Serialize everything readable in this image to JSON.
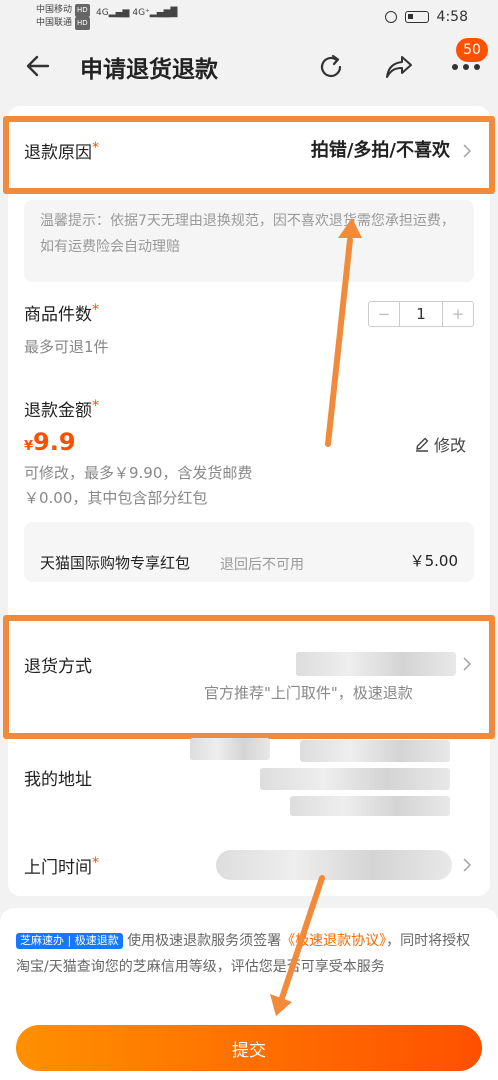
{
  "status_bar": {
    "carrier1": "中国移动",
    "carrier2": "中国联通",
    "hd": "HD",
    "net1": "4G",
    "net2": "4G⁺",
    "time": "4:58"
  },
  "nav": {
    "title": "申请退货退款",
    "badge": "50"
  },
  "refund_reason": {
    "label": "退款原因",
    "required": "*",
    "value": "拍错/多拍/不喜欢"
  },
  "tip": {
    "text": "温馨提示：依据7天无理由退换规范，因不喜欢退货需您承担运费，如有运费险会自动理赔"
  },
  "quantity": {
    "label": "商品件数",
    "required": "*",
    "sub": "最多可退1件",
    "minus": "−",
    "value": "1",
    "plus": "+"
  },
  "refund_amount": {
    "label": "退款金额",
    "required": "*",
    "currency": "¥",
    "value": "9.9",
    "edit_label": "修改",
    "note_line1": "可修改，最多￥9.90，含发货邮费",
    "note_line2": "￥0.00，其中包含部分红包"
  },
  "red_packet": {
    "title": "天猫国际购物专享红包",
    "note": "退回后不可用",
    "value": "￥5.00"
  },
  "return_method": {
    "label": "退货方式",
    "sub": "官方推荐\"上门取件\"，极速退款"
  },
  "address": {
    "label": "我的地址"
  },
  "pickup_time": {
    "label": "上门时间",
    "required": "*"
  },
  "agreement": {
    "badge": "芝麻速办 | 极速退款",
    "text1": "使用极速退款服务须签署",
    "link": "《极速退款协议》",
    "text2": "，同时将授权淘宝/天猫查询您的芝麻信用等级，评估您是否可享受本服务"
  },
  "submit": {
    "label": "提交"
  },
  "colors": {
    "accent": "#ff5000",
    "highlight_box": "#f28a3b"
  }
}
